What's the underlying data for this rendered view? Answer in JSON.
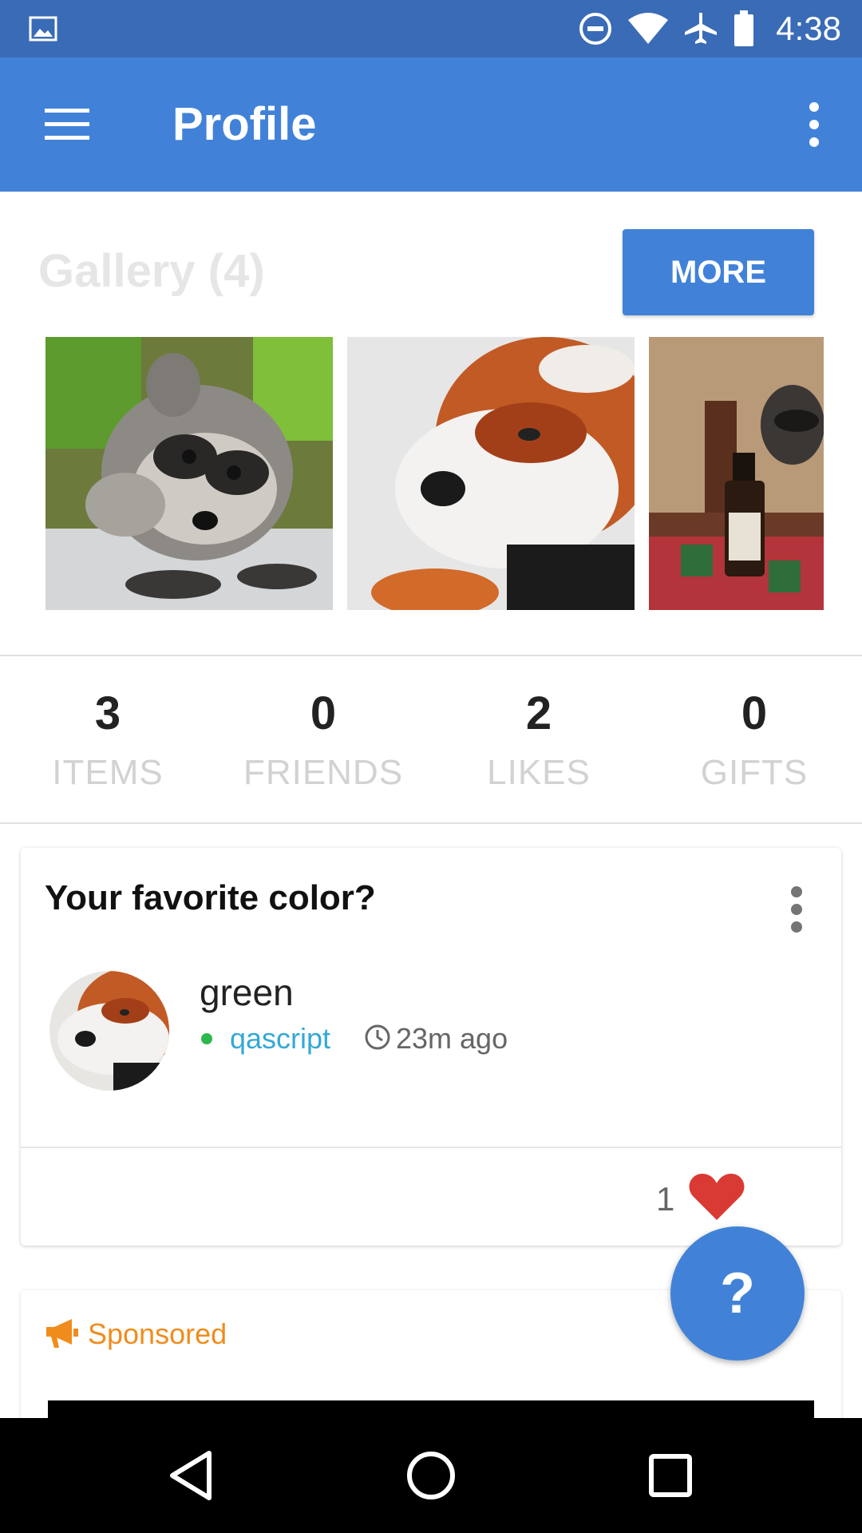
{
  "status_bar": {
    "time": "4:38",
    "icons": [
      "gallery-notification-icon",
      "do-not-disturb-icon",
      "wifi-icon",
      "airplane-mode-icon",
      "battery-icon"
    ]
  },
  "app_bar": {
    "title": "Profile",
    "menu_icon": "hamburger-menu-icon",
    "overflow_icon": "more-vertical-icon"
  },
  "gallery": {
    "title": "Gallery (4)",
    "more_label": "MORE",
    "thumbnails": [
      "raccoon-photo",
      "red-panda-photo",
      "raccoon-with-bottle-photo"
    ]
  },
  "stats": [
    {
      "value": "3",
      "label": "ITEMS"
    },
    {
      "value": "0",
      "label": "FRIENDS"
    },
    {
      "value": "2",
      "label": "LIKES"
    },
    {
      "value": "0",
      "label": "GIFTS"
    }
  ],
  "question_card": {
    "title": "Your favorite color?",
    "answer": "green",
    "username": "qascript",
    "time_ago": "23m ago",
    "likes": "1"
  },
  "sponsored_card": {
    "label": "Sponsored"
  },
  "fab": {
    "label": "?"
  },
  "colors": {
    "status_bar": "#3a6bb6",
    "app_bar": "#4182d8",
    "accent": "#4182d8",
    "username": "#35a8d6",
    "online": "#2db84c",
    "heart": "#d93a33",
    "sponsored": "#f08c1c"
  }
}
